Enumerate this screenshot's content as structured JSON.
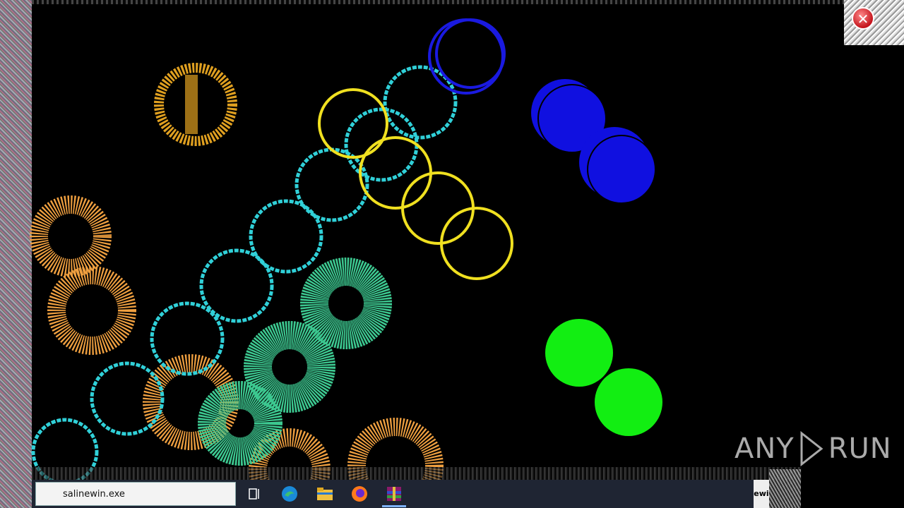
{
  "taskbar": {
    "search_value": "salinewin.exe",
    "right_block_text": "ewi"
  },
  "watermark": {
    "left": "ANY",
    "right": "RUN"
  },
  "icons": [
    "close-icon",
    "task-view-icon",
    "edge-icon",
    "file-explorer-icon",
    "firefox-icon",
    "winrar-icon"
  ],
  "colors": {
    "taskbar": "#1f2533",
    "blue": "#1010e0",
    "green": "#12ee12",
    "yellow": "#f0e020",
    "cyan": "#30d0d8",
    "orange": "#f0a040",
    "teal": "#3cc890"
  }
}
